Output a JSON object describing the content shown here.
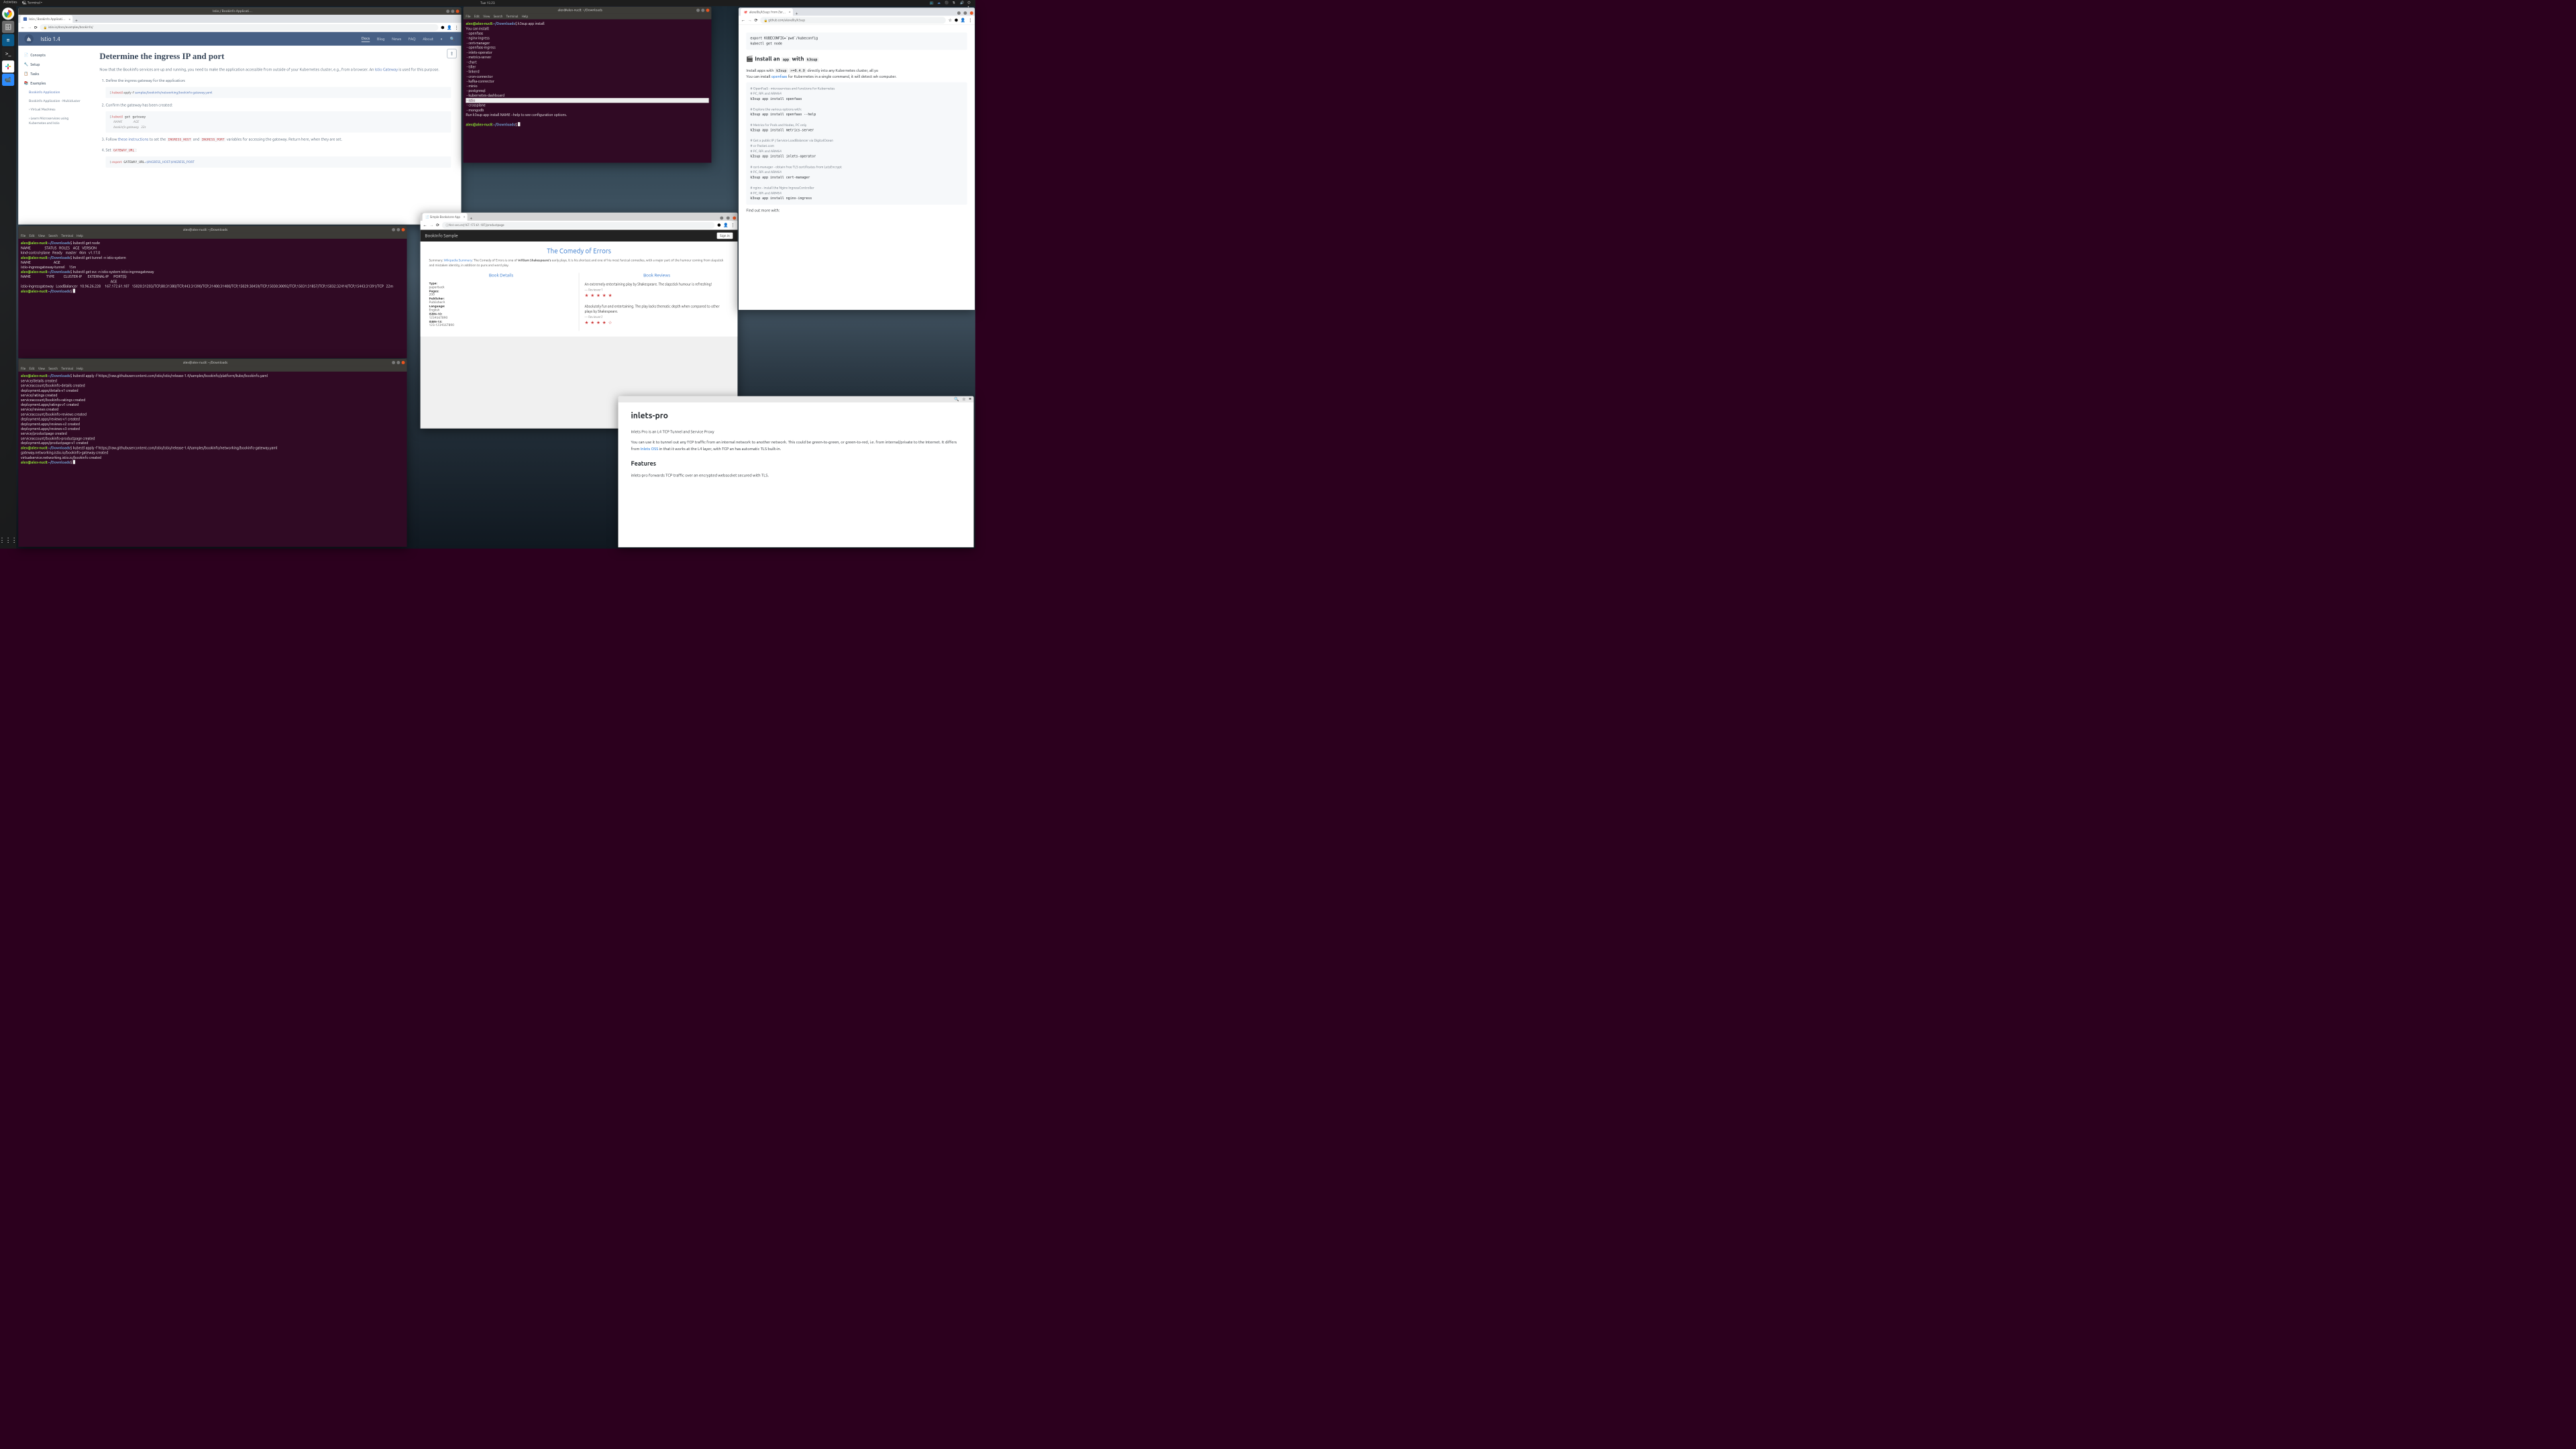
{
  "topbar": {
    "activities": "Activities",
    "app": "Terminal",
    "clock": "Tue 15:23"
  },
  "istio_win_title": "Istio / Bookinfo Applicati…",
  "istio_url": "istio.io/docs/examples/bookinfo/",
  "istio": {
    "brand": "Istio 1.4",
    "nav": [
      "Docs",
      "Blog",
      "News",
      "FAQ",
      "About"
    ],
    "nav_active": 0,
    "sidebar": {
      "concepts": "Concepts",
      "setup": "Setup",
      "tasks": "Tasks",
      "examples": "Examples",
      "bookinfo": "Bookinfo Application",
      "bookinfo_mc": "Bookinfo Application - Multicluster",
      "vm": "Virtual Machines",
      "learn": "Learn Microservices using Kubernetes and Istio"
    },
    "h1": "Determine the ingress IP and port",
    "intro_1": "Now that the Bookinfo services are up and running, you need to make the application accessible from outside of your Kubernetes cluster, e.g., from a browser. An ",
    "intro_link": "Istio Gateway",
    "intro_2": " is used for this purpose.",
    "li1": "Define the ingress gateway for the application:",
    "code1_prompt": "$ ",
    "code1_cmd": "kubectl",
    "code1_args": " apply -f ",
    "code1_path": "samples/bookinfo/networking/bookinfo-gateway.yaml",
    "li2": "Confirm the gateway has been created:",
    "code2": "$ kubectl get gateway\n  NAME               AGE\n  bookinfo-gateway   32s",
    "li3_a": "Follow ",
    "li3_link": "these instructions",
    "li3_b": " to set the ",
    "li3_c1": "INGRESS_HOST",
    "li3_and": " and ",
    "li3_c2": "INGRESS_PORT",
    "li3_c": " variables for accessing the gateway. Return here, when they are set.",
    "li4_a": "Set ",
    "li4_code": "GATEWAY_URL",
    "li4_b": ":",
    "code4": "$ export GATEWAY_URL=$INGRESS_HOST:$INGRESS_PORT"
  },
  "term_top": {
    "title": "alex@alex-nuc8: ~/Downloads",
    "menus": [
      "File",
      "Edit",
      "View",
      "Search",
      "Terminal",
      "Help"
    ],
    "body": "alex@alex-nuc8:~/Downloads$ k3sup app install\nYou can install:\n - openfaas\n - nginx-ingress\n - cert-manager\n - openfaas-ingress\n - inlets-operator\n - metrics-server\n - chart\n - tiller\n - linkerd\n - cron-connector\n - kafka-connector\n - minio\n - postgresql\n - kubernetes-dashboard",
    "hl": " - istio",
    "body2": " - crossplane\n - mongodb\nRun k3sup app install NAME --help to see configuration options.\n\nalex@alex-nuc8:~/Downloads$ "
  },
  "term_mid": {
    "title": "alex@alex-nuc8: ~/Downloads",
    "body": "alex@alex-nuc8:~/Downloads$ kubectl get node\nNAME                 STATUS   ROLES    AGE   VERSION\nkind-control-plane   Ready    master   46m   v1.17.0\nalex@alex-nuc8:~/Downloads$ kubectl get tunnel -n istio-system\nNAME                            AGE\nistio-ingressgateway-tunnel     15m\nalex@alex-nuc8:~/Downloads$ kubectl get svc -n istio-system istio-ingressgateway\nNAME                   TYPE           CLUSTER-IP       EXTERNAL-IP      PORT(S)\n                                                                                                              AGE\nistio-ingressgateway   LoadBalancer   10.96.26.228     167.172.61.187   15020:31203/TCP,80:31380/TCP,443:31390/TCP,31400:31400/TCP,15029:30459/TCP,15030:30092/TCP,15031:31857/TCP,15032:32414/TCP,15443:31391/TCP   22m\nalex@alex-nuc8:~/Downloads$ "
  },
  "term_bot": {
    "title": "alex@alex-nuc8: ~/Downloads",
    "body": "alex@alex-nuc8:~/Downloads$ kubectl apply -f https://raw.githubusercontent.com/istio/istio/release-1.4/samples/bookinfo/platform/kube/bookinfo.yaml\nservice/details created\nserviceaccount/bookinfo-details created\ndeployment.apps/details-v1 created\nservice/ratings created\nserviceaccount/bookinfo-ratings created\ndeployment.apps/ratings-v1 created\nservice/reviews created\nserviceaccount/bookinfo-reviews created\ndeployment.apps/reviews-v1 created\ndeployment.apps/reviews-v2 created\ndeployment.apps/reviews-v3 created\nservice/productpage created\nserviceaccount/bookinfo-productpage created\ndeployment.apps/productpage-v1 created\nalex@alex-nuc8:~/Downloads$ kubectl apply -f https://raw.githubusercontent.com/istio/istio/release-1.4/samples/bookinfo/networking/bookinfo-gateway.yaml\ngateway.networking.istio.io/bookinfo-gateway created\nvirtualservice.networking.istio.io/bookinfo created\nalex@alex-nuc8:~/Downloads$ "
  },
  "bookstore": {
    "tab": "Simple Bookstore App",
    "url_prefix": "Not secure",
    "url": "167.172.61.187/productpage",
    "header": "BookInfo Sample",
    "signin": "Sign in",
    "title": "The Comedy of Errors",
    "sum_a": "Summary: ",
    "sum_link": "Wikipedia Summary",
    "sum_b": ": The Comedy of Errors is one of ",
    "sum_bold": "William Shakespeare's",
    "sum_c": " early plays. It is his shortest and one of his most farcical comedies, with a major part of the humour coming from slapstick and mistaken identity, in addition to puns and word play.",
    "col1": "Book Details",
    "col2": "Book Reviews",
    "details": [
      {
        "k": "Type:",
        "v": "paperback"
      },
      {
        "k": "Pages:",
        "v": "200"
      },
      {
        "k": "Publisher:",
        "v": "PublisherA"
      },
      {
        "k": "Language:",
        "v": "English"
      },
      {
        "k": "ISBN-10:",
        "v": "1234567890"
      },
      {
        "k": "ISBN-13:",
        "v": "123-1234567890"
      }
    ],
    "rev1": {
      "t": "An extremely entertaining play by Shakespeare. The slapstick humour is refreshing!",
      "by": "— Reviewer1",
      "stars": "★ ★ ★ ★ ★"
    },
    "rev2": {
      "t": "Absolutely fun and entertaining. The play lacks thematic depth when compared to other plays by Shakespeare.",
      "by": "— Reviewer2",
      "stars": "★ ★ ★ ★ ☆"
    }
  },
  "k3sup": {
    "tab": "alexellis/k3sup: from Zer…",
    "url": "github.com/alexellis/k3sup",
    "pre_top": "export KUBECONFIG=`pwd`/kubeconfig\nkubectl get node",
    "h2_a": "🎬 Install an ",
    "h2_b": "app",
    "h2_c": " with ",
    "h2_d": "k3sup",
    "p1_a": "Install apps with ",
    "p1_code1": "k3sup",
    "p1_code2": ">=0.4.0",
    "p1_b": " directly into any Kubernetes cluster, all yo",
    "p2_a": "You can install ",
    "p2_link": "openfaas",
    "p2_b": " for Kubernetes in a single command, it will detect wh computer.",
    "pre_body": "# OpenFaaS - microservices and functions for Kubernetes\n# PC, RPi and ARM64\nk3sup app install openfaas\n\n# Explore the various options with:\nk3sup app install openfaas --help\n\n# Metrics for Pods and Nodes, PC only\nk3sup app install metrics-server\n\n# Get a public IP / Service LoadBalancer via DigitalOcean\n# or Packet.com\n# PC, RPi and ARM64\nk3sup app install inlets-operator\n\n# cert-manager - obtain free TLS certificates from LetsEncrypt\n# PC, RPi and ARM64\nk3sup app install cert-manager\n\n# nginx - install the Nginx IngressController\n# PC, RPi and ARM64\nk3sup app install nginx-ingress",
    "p3": "Find out more with:"
  },
  "inlets": {
    "h1": "inlets-pro",
    "p1": "Inlets Pro is an L4 TCP Tunnel and Service Proxy",
    "p2_a": "You can use it to tunnel out any TCP traffic from an internal network to another network. This could be green-to-green, or green-to-red, i.e. from internal/private to the Internet. It differs from ",
    "p2_link": "Inlets OSS",
    "p2_b": " in that it works at the L4 layer, with TCP an has automatic TLS built-in.",
    "h2": "Features",
    "p3": "inlets-pro forwards TCP traffic over an encrypted websocket secured with TLS."
  }
}
